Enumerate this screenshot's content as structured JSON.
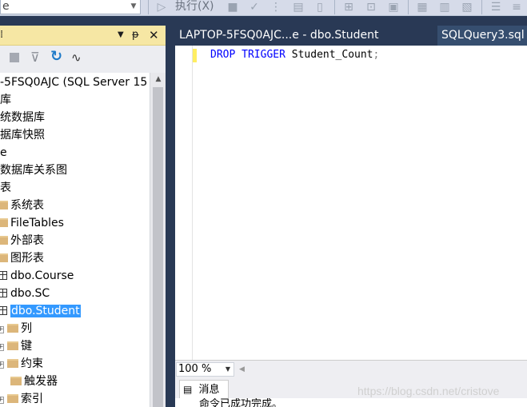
{
  "toolbar": {
    "combo_value": "e",
    "execute_label": "执行(X)"
  },
  "object_explorer": {
    "header_pin": "▼ ᵽ",
    "server": "-5FSQ0AJC (SQL Server 15",
    "nodes": [
      {
        "label": "库"
      },
      {
        "label": "统数据库"
      },
      {
        "label": "据库快照"
      },
      {
        "label": "e"
      },
      {
        "label": "数据库关系图"
      },
      {
        "label": "表"
      },
      {
        "label": "系统表"
      },
      {
        "label": "FileTables"
      },
      {
        "label": "外部表"
      },
      {
        "label": "图形表"
      },
      {
        "label": "dbo.Course"
      },
      {
        "label": "dbo.SC"
      },
      {
        "label": "dbo.Student"
      },
      {
        "label": "列"
      },
      {
        "label": "键"
      },
      {
        "label": "约束"
      },
      {
        "label": "触发器"
      },
      {
        "label": "索引"
      }
    ]
  },
  "tabs": {
    "active": "LAPTOP-5FSQ0AJC...e - dbo.Student",
    "other": "SQLQuery3.sql"
  },
  "editor": {
    "kw1": "DROP",
    "kw2": "TRIGGER",
    "ident": "Student_Count",
    "punct": ";"
  },
  "zoom": {
    "value": "100 %"
  },
  "messages": {
    "tab_label": "消息",
    "text": "命令已成功完成。"
  },
  "watermark": "https://blog.csdn.net/cristove"
}
